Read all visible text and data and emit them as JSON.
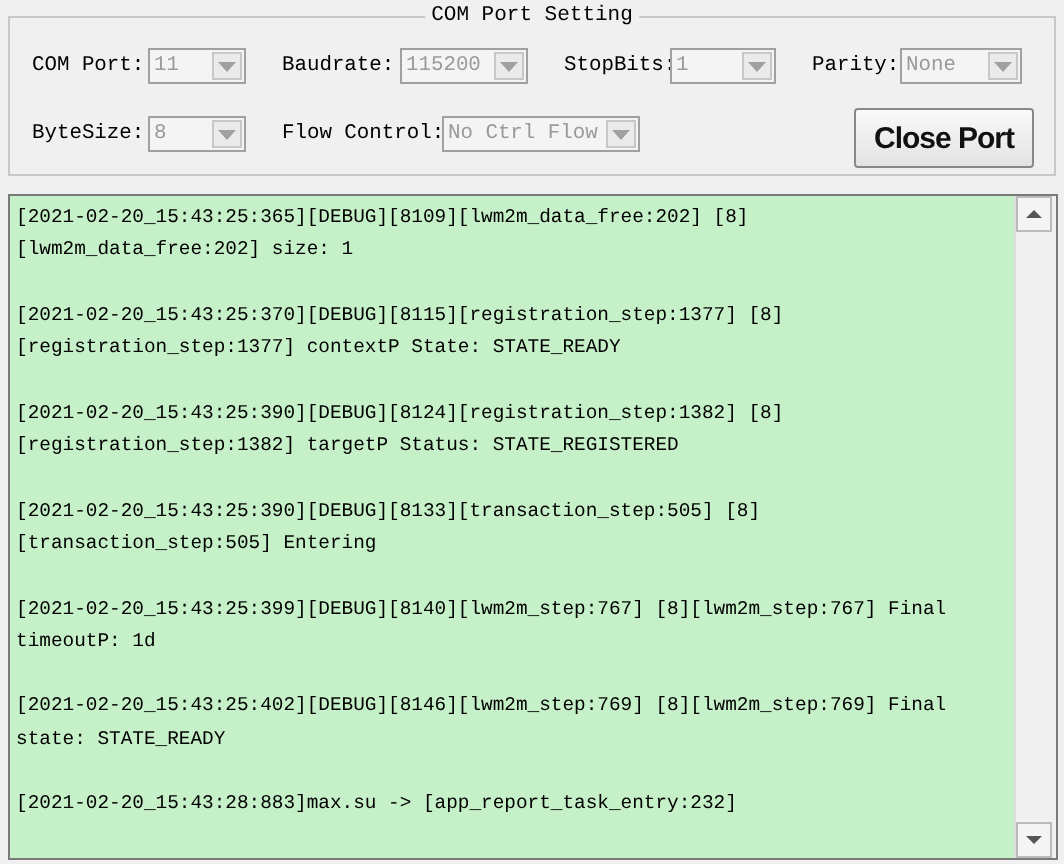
{
  "settings": {
    "title": "COM Port Setting",
    "fields": [
      {
        "label": "COM Port:",
        "value": "11",
        "disabled": true
      },
      {
        "label": "Baudrate:",
        "value": "115200",
        "disabled": true
      },
      {
        "label": "StopBits:",
        "value": "1",
        "disabled": true
      },
      {
        "label": "Parity:",
        "value": "None",
        "disabled": true
      },
      {
        "label": "ByteSize:",
        "value": "8",
        "disabled": true
      },
      {
        "label": "Flow Control:",
        "value": "No Ctrl Flow",
        "disabled": true
      }
    ],
    "button": "Close Port"
  },
  "log": [
    {
      "lines": [
        "[2021-02-20_15:43:25:365][DEBUG][8109][lwm2m_data_free:202] [8]",
        "[lwm2m_data_free:202] size: 1"
      ]
    },
    {
      "lines": [
        "[2021-02-20_15:43:25:370][DEBUG][8115][registration_step:1377] [8]",
        "[registration_step:1377] contextP State: STATE_READY"
      ]
    },
    {
      "lines": [
        "[2021-02-20_15:43:25:390][DEBUG][8124][registration_step:1382] [8]",
        "[registration_step:1382] targetP Status: STATE_REGISTERED"
      ]
    },
    {
      "lines": [
        "[2021-02-20_15:43:25:390][DEBUG][8133][transaction_step:505] [8]",
        "[transaction_step:505] Entering"
      ]
    },
    {
      "lines": [
        "[2021-02-20_15:43:25:399][DEBUG][8140][lwm2m_step:767] [8][lwm2m_step:767] Final",
        "timeoutP: 1d"
      ]
    },
    {
      "lines": [
        "[2021-02-20_15:43:25:402][DEBUG][8146][lwm2m_step:769] [8][lwm2m_step:769] Final",
        "state: STATE_READY"
      ]
    },
    {
      "lines": [
        "[2021-02-20_15:43:28:883]max.su -> [app_report_task_entry:232]"
      ]
    }
  ]
}
